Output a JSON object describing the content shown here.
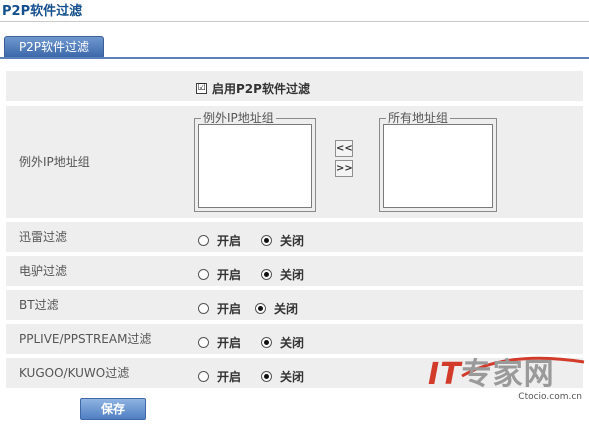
{
  "page": {
    "title": "P2P软件过滤"
  },
  "tab": {
    "label": "P2P软件过滤"
  },
  "enable": {
    "label": "启用P2P软件过滤",
    "checked": true,
    "mark": "☑"
  },
  "exception": {
    "row_label": "例外IP地址组",
    "left_group_legend": "例外IP地址组",
    "right_group_legend": "所有地址组",
    "move_left": "<<",
    "move_right": ">>"
  },
  "filters": [
    {
      "label": "迅雷过滤",
      "on_label": "开启",
      "off_label": "关闭",
      "value": "off"
    },
    {
      "label": "电驴过滤",
      "on_label": "开启",
      "off_label": "关闭",
      "value": "off"
    },
    {
      "label": "BT过滤",
      "on_label": "开启",
      "off_label": "关闭",
      "value": "off"
    },
    {
      "label": "PPLIVE/PPSTREAM过滤",
      "on_label": "开启",
      "off_label": "关闭",
      "value": "off"
    },
    {
      "label": "KUGOO/KUWO过滤",
      "on_label": "开启",
      "off_label": "关闭",
      "value": "off"
    }
  ],
  "save": {
    "label": "保存"
  },
  "watermark": {
    "main_prefix": "IT",
    "main_suffix": "专家网",
    "sub": "Ctocio.com.cn"
  },
  "colors": {
    "accent": "#15508e",
    "row_bg": "#eeeeee",
    "button": "#4f7fc2",
    "watermark_red": "#d23a2a"
  },
  "icons": {
    "move_left": "double-chevron-left-icon",
    "move_right": "double-chevron-right-icon"
  }
}
